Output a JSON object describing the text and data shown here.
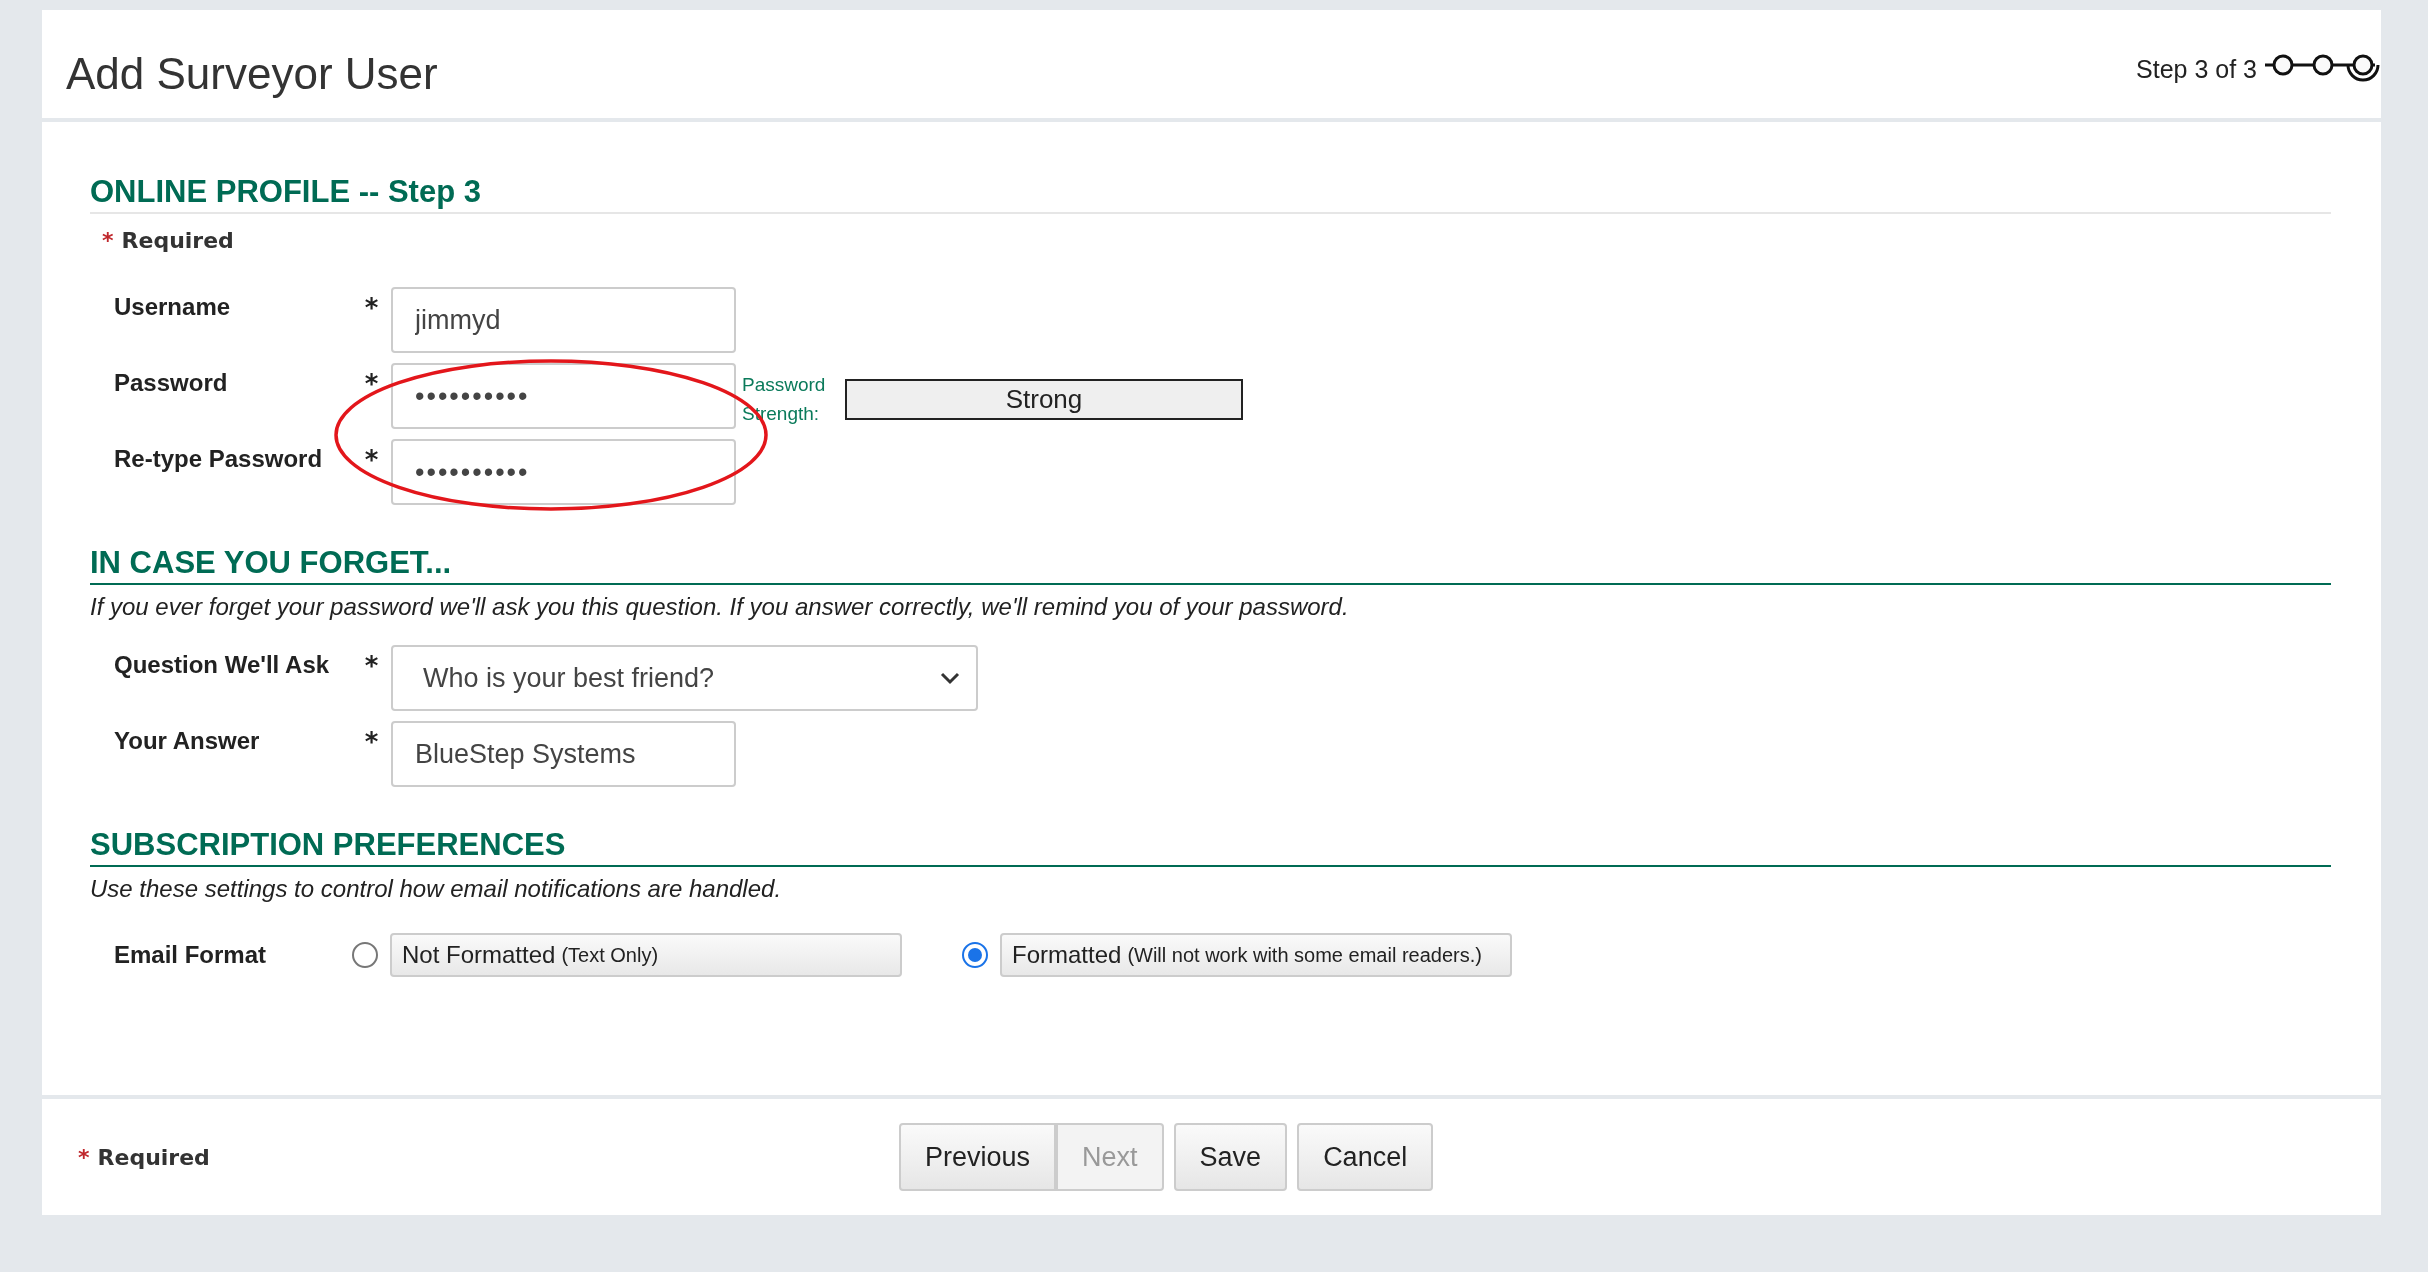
{
  "header": {
    "title": "Add Surveyor User",
    "step": "Step 3 of 3"
  },
  "profile": {
    "heading": "ONLINE PROFILE -- Step 3",
    "legend": {
      "mark": "*",
      "label": "Required"
    },
    "fields": [
      {
        "label": "Username",
        "mark": "*",
        "value": "jimmyd",
        "kind": "text"
      },
      {
        "label": "Password",
        "mark": "*",
        "value": "••••••••••",
        "kind": "password",
        "strength_label": "Password Strength:",
        "strength": "Strong"
      },
      {
        "label": "Re-type Password",
        "mark": "*",
        "value": "••••••••••",
        "kind": "password"
      }
    ]
  },
  "recovery": {
    "heading": "IN CASE YOU FORGET...",
    "description": "If you ever forget your password we'll ask you this question. If you answer correctly, we'll remind you of your password.",
    "fields": [
      {
        "label": "Question We'll Ask",
        "mark": "*",
        "value": "Who is your best friend?",
        "kind": "select"
      },
      {
        "label": "Your Answer",
        "mark": "*",
        "value": "BlueStep Systems",
        "kind": "text"
      }
    ]
  },
  "subscription": {
    "heading": "SUBSCRIPTION PREFERENCES",
    "description": "Use these settings to control how email notifications are handled.",
    "label": "Email Format",
    "options": [
      {
        "label": "Not Formatted",
        "note": "(Text Only)",
        "selected": false
      },
      {
        "label": "Formatted",
        "note": "(Will not work with some email readers.)",
        "selected": true
      }
    ]
  },
  "footer": {
    "legend": {
      "mark": "*",
      "label": "Required"
    },
    "buttons": [
      {
        "label": "Previous",
        "disabled": false
      },
      {
        "label": "Next",
        "disabled": true
      },
      {
        "label": "Save",
        "disabled": false
      },
      {
        "label": "Cancel",
        "disabled": false
      }
    ]
  }
}
